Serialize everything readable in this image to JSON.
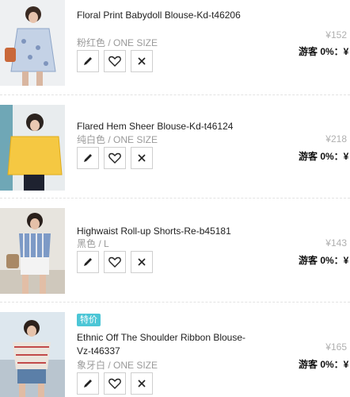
{
  "items": [
    {
      "title": "Floral Print Babydoll Blouse-Kd-t46206",
      "variant": "粉红色 / ONE SIZE",
      "price": "¥152",
      "member_discount": "游客 0%：¥",
      "badge": "",
      "image_alt": "model in floral blouse"
    },
    {
      "title": "Flared Hem Sheer Blouse-Kd-t46124",
      "variant": "纯白色 / ONE SIZE",
      "price": "¥218",
      "member_discount": "游客 0%：¥",
      "badge": "",
      "image_alt": "model in yellow sheer blouse"
    },
    {
      "title": "Highwaist Roll-up Shorts-Re-b45181",
      "variant": "黑色 / L",
      "price": "¥143",
      "member_discount": "游客 0%：¥",
      "badge": "",
      "image_alt": "model in white shorts"
    },
    {
      "title": "Ethnic Off The Shoulder Ribbon Blouse-Vz-t46337",
      "variant": "象牙白 / ONE SIZE",
      "price": "¥165",
      "member_discount": "游客 0%：¥",
      "badge": "特价",
      "image_alt": "model in off shoulder blouse"
    }
  ],
  "colors": {
    "badge": "#4cc6d6",
    "price": "#b0b0b0",
    "variant": "#9a9a9a"
  },
  "icons": [
    "pencil-icon",
    "heart-icon",
    "close-icon"
  ]
}
